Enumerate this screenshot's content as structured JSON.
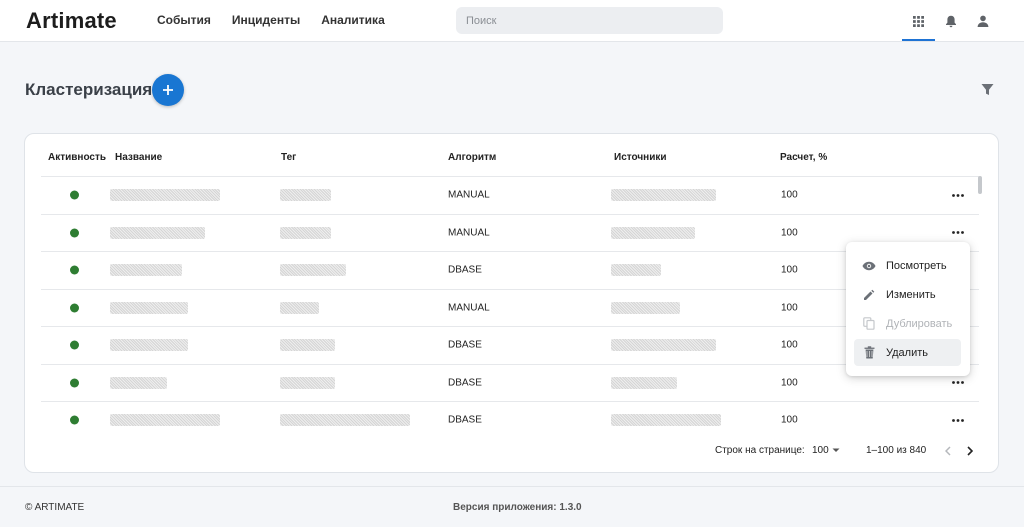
{
  "header": {
    "logo": "Artimate",
    "nav": [
      "События",
      "Инциденты",
      "Аналитика"
    ],
    "search_placeholder": "Поиск",
    "icons": [
      "apps-grid-icon",
      "bell-icon",
      "user-icon"
    ],
    "accent_color": "#1e73d4"
  },
  "page": {
    "title": "Кластеризация",
    "add_icon": "plus-icon",
    "filter_icon": "filter-icon"
  },
  "table": {
    "columns": [
      "Активность",
      "Название",
      "Тег",
      "Алгоритм",
      "Источники",
      "Расчет, %"
    ],
    "rows": [
      {
        "active": true,
        "algorithm": "MANUAL",
        "calc": "100"
      },
      {
        "active": true,
        "algorithm": "MANUAL",
        "calc": "100"
      },
      {
        "active": true,
        "algorithm": "DBASE",
        "calc": "100"
      },
      {
        "active": true,
        "algorithm": "MANUAL",
        "calc": "100"
      },
      {
        "active": true,
        "algorithm": "DBASE",
        "calc": "100"
      },
      {
        "active": true,
        "algorithm": "DBASE",
        "calc": "100"
      },
      {
        "active": true,
        "algorithm": "DBASE",
        "calc": "100"
      }
    ],
    "active_color": "#2e7d32"
  },
  "context_menu": {
    "items": [
      {
        "label": "Посмотреть",
        "icon": "eye-icon",
        "disabled": false
      },
      {
        "label": "Изменить",
        "icon": "pencil-icon",
        "disabled": false
      },
      {
        "label": "Дублировать",
        "icon": "copy-icon",
        "disabled": true
      },
      {
        "label": "Удалить",
        "icon": "trash-icon",
        "disabled": false
      }
    ]
  },
  "pagination": {
    "rows_per_page_label": "Строк на странице:",
    "rows_per_page": "100",
    "range": "1–100 из 840"
  },
  "footer": {
    "copyright": "© ARTIMATE",
    "version": "Версия приложения: 1.3.0"
  }
}
